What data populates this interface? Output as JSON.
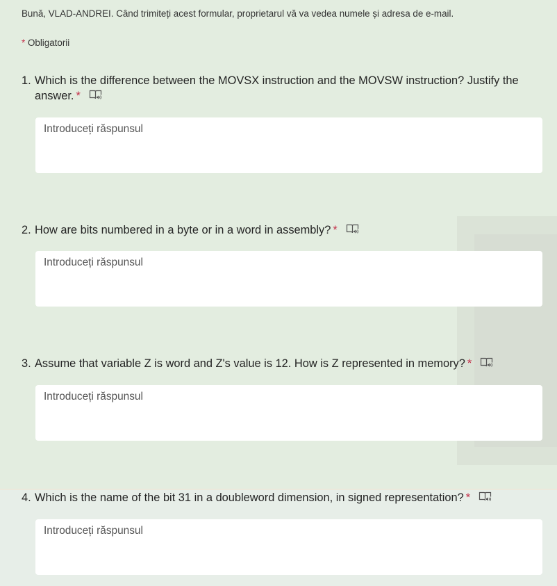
{
  "form": {
    "greeting": "Bună, VLAD-ANDREI. Când trimiteți acest formular, proprietarul vă va vedea numele și adresa de e-mail.",
    "required_star": "*",
    "required_label": "Obligatorii"
  },
  "questions": [
    {
      "number": "1.",
      "text": "Which is the difference between the MOVSX instruction and the MOVSW instruction? Justify the answer.",
      "required_star": "*",
      "icon": "immersive-reader-icon",
      "answer_placeholder": "Introduceți răspunsul",
      "answer_value": ""
    },
    {
      "number": "2.",
      "text": "How are bits numbered in a byte or in a word in assembly?",
      "required_star": "*",
      "icon": "immersive-reader-icon",
      "answer_placeholder": "Introduceți răspunsul",
      "answer_value": ""
    },
    {
      "number": "3.",
      "text": "Assume that variable Z is word and Z's value is 12. How is Z represented in memory?",
      "required_star": "*",
      "icon": "immersive-reader-icon",
      "answer_placeholder": "Introduceți răspunsul",
      "answer_value": ""
    },
    {
      "number": "4.",
      "text": "Which is the name of the bit 31 in a doubleword dimension, in signed representation?",
      "required_star": "*",
      "icon": "immersive-reader-icon",
      "answer_placeholder": "Introduceți răspunsul",
      "answer_value": ""
    }
  ],
  "colors": {
    "background": "#e3ede0",
    "required_star": "#c4314b",
    "text": "#242424",
    "answer_box": "#ffffff"
  }
}
